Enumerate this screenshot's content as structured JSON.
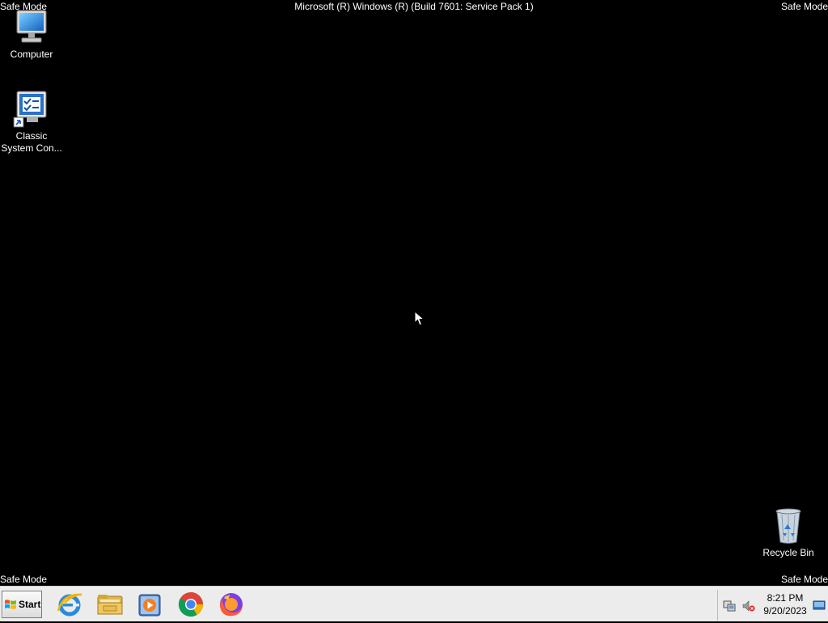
{
  "overlay": {
    "safe_mode_top_left": "Safe Mode",
    "safe_mode_top_right": "Safe Mode",
    "safe_mode_bottom_left": "Safe Mode",
    "safe_mode_bottom_right": "Safe Mode",
    "build_string": "Microsoft (R) Windows (R) (Build 7601: Service Pack 1)"
  },
  "desktop": {
    "icons": [
      {
        "label": "Computer",
        "icon": "computer-icon"
      },
      {
        "label": "Classic\nSystem Con...",
        "label_line1": "Classic",
        "label_line2": "System Con...",
        "icon": "control-panel-shortcut-icon"
      },
      {
        "label": "Recycle Bin",
        "icon": "recycle-bin-icon"
      }
    ]
  },
  "taskbar": {
    "start_label": "Start",
    "pinned": [
      {
        "name": "internet-explorer",
        "icon": "internet-explorer-icon"
      },
      {
        "name": "windows-explorer",
        "icon": "folder-icon"
      },
      {
        "name": "windows-media-player",
        "icon": "media-player-icon"
      },
      {
        "name": "google-chrome",
        "icon": "chrome-icon"
      },
      {
        "name": "firefox",
        "icon": "firefox-icon"
      }
    ],
    "tray": {
      "icons": [
        "network-icon",
        "volume-muted-icon",
        "show-desktop-icon"
      ],
      "time": "8:21 PM",
      "date": "9/20/2023"
    }
  },
  "colors": {
    "desktop_bg": "#000000",
    "taskbar_bg": "#ececec",
    "text_overlay": "#ffffff"
  }
}
